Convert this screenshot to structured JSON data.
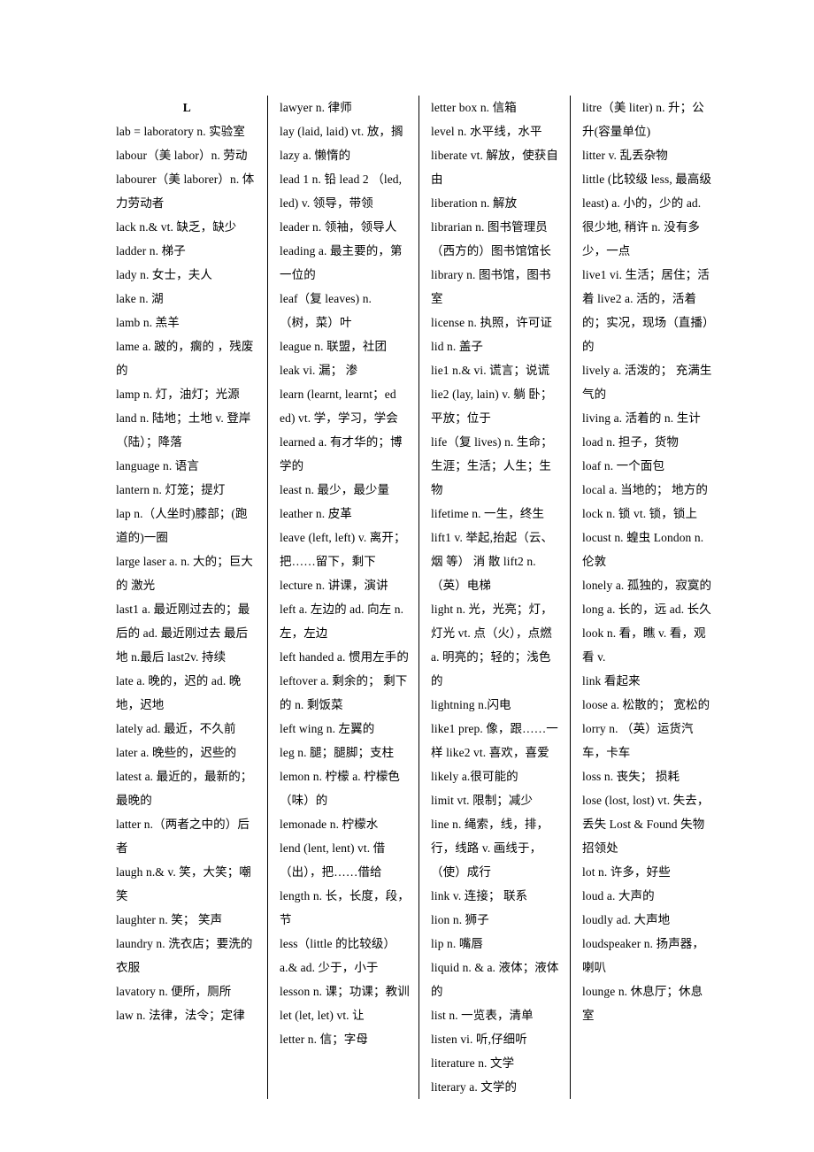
{
  "document": {
    "section_letter": "L",
    "type": "english-chinese vocabulary list"
  },
  "columns": [
    {
      "id": "column-1",
      "heading": "L",
      "entries": [
        "lab = laboratory n. 实验室  labour（美 labor）n. 劳动",
        "labourer（美 laborer）n. 体力劳动者",
        "lack n.& vt. 缺乏，缺少",
        "ladder n. 梯子",
        "lady n. 女士，夫人",
        "lake n. 湖",
        "lamb n. 羔羊",
        "lame a. 跛的，瘸的 ，残废的",
        "lamp n. 灯，油灯；光源",
        "land n. 陆地；土地  v. 登岸（陆）；降落",
        "language n. 语言",
        "lantern n. 灯笼；提灯",
        "lap n.（人坐时)膝部；(跑道的)一圈",
        "large laser a. n. 大的；巨大的  激光",
        "last1 a. 最近刚过去的；最后的 ad. 最近刚过去 最后地  n.最后  last2v. 持续",
        "late a. 晚的，迟的 ad. 晚地，迟地",
        "lately ad. 最近，不久前",
        "later a.  晚些的，迟些的",
        "latest a. 最近的，最新的；最晚的",
        "latter n.（两者之中的）后者",
        "laugh n.& v. 笑，大笑；嘲笑",
        "laughter n. 笑；  笑声",
        "laundry n. 洗衣店；要洗的衣服",
        "lavatory n. 便所，厕所",
        "law n. 法律，法令；定律"
      ]
    },
    {
      "id": "column-2",
      "heading": "",
      "entries": [
        "lawyer n. 律师",
        "lay (laid, laid) vt. 放，搁",
        "lazy a. 懒惰的",
        "lead 1  n. 铅  lead 2 （led, led) v. 领导，带领",
        "leader n. 领袖，领导人",
        "leading a. 最主要的，第一位的",
        "leaf（复 leaves) n. （树，菜）叶",
        "league n. 联盟，社团",
        "leak vi. 漏；  渗",
        "learn (learnt, learnt；ed    ed) vt. 学，学习，学会",
        "learned a. 有才华的；博学的",
        "least n. 最少，最少量",
        "leather n. 皮革",
        "leave (left, left) v. 离开；把……留下，剩下",
        "lecture n. 讲课，演讲",
        "left a. 左边的 ad. 向左 n. 左，左边",
        "left   handed a. 惯用左手的",
        "leftover a. 剩余的；  剩下的 n. 剩饭菜",
        "left   wing n. 左翼的",
        "leg n. 腿；腿脚；支柱",
        "lemon n. 柠檬 a. 柠檬色（味）的",
        "lemonade n. 柠檬水",
        "lend (lent, lent) vt. 借（出），把……借给",
        "length n. 长，长度，段，节",
        "less（little 的比较级）a.& ad. 少于，小于",
        "lesson n. 课；功课；教训",
        "let (let, let) vt. 让",
        "letter n. 信；字母"
      ]
    },
    {
      "id": "column-3",
      "heading": "",
      "entries": [
        "letter   box n. 信箱",
        "level n. 水平线，水平",
        "liberate vt. 解放，使获自由",
        "liberation n. 解放",
        "librarian n. 图书管理员（西方的）图书馆馆长",
        "library n. 图书馆，图书室",
        "license n. 执照，许可证",
        "lid n. 盖子",
        "lie1 n.& vi. 谎言；说谎",
        "lie2 (lay, lain) v. 躺 卧；平放；位于",
        "life（复 lives) n. 生命；生涯；生活；人生；生物",
        "lifetime n. 一生，终生",
        "lift1 v. 举起,抬起（云、烟 等） 消 散  lift2 n. （英）电梯",
        "light n. 光，光亮；灯，灯光 vt. 点（火），点燃 a. 明亮的；轻的；浅色的",
        "lightning n.闪电",
        "like1 prep. 像，跟……一样  like2 vt. 喜欢，喜爱",
        "likely a.很可能的",
        "limit vt. 限制；减少",
        "line n. 绳索，线，排，行，线路 v. 画线于，（使）成行",
        "link v. 连接；  联系",
        "lion n. 狮子",
        "lip n. 嘴唇",
        "liquid n. & a. 液体；液体的",
        "list n. 一览表，清单",
        "listen vi. 听,仔细听",
        "literature n. 文学",
        "literary a. 文学的"
      ]
    },
    {
      "id": "column-4",
      "heading": "",
      "entries": [
        "litre（美 liter) n. 升；公升(容量单位)",
        "litter v. 乱丢杂物",
        "little (比较级 less, 最高级 least) a. 小的，少的 ad. 很少地, 稍许 n. 没有多少，一点",
        "live1 vi. 生活；居住；活着 live2 a. 活的，活着的；实况，现场（直播）的",
        "lively a. 活泼的；  充满生气的",
        "living a. 活着的 n. 生计",
        "load n. 担子，货物",
        "loaf n. 一个面包",
        "local a. 当地的；  地方的",
        "lock n. 锁 vt. 锁，锁上",
        "locust n. 蝗虫 London n. 伦敦",
        "lonely a. 孤独的，寂寞的",
        "long a. 长的，远 ad. 长久",
        "look n. 看，瞧 v. 看，观看 v.",
        "link     看起来",
        "loose a. 松散的；  宽松的",
        "lorry n. （英）运货汽车，卡车",
        "loss n. 丧失；  损耗",
        "lose (lost, lost) vt. 失去，丢失 Lost & Found 失物招领处",
        "lot n. 许多，好些",
        "loud a. 大声的",
        "loudly ad. 大声地",
        "loudspeaker n. 扬声器，喇叭",
        "lounge n. 休息厅；休息室"
      ]
    }
  ]
}
